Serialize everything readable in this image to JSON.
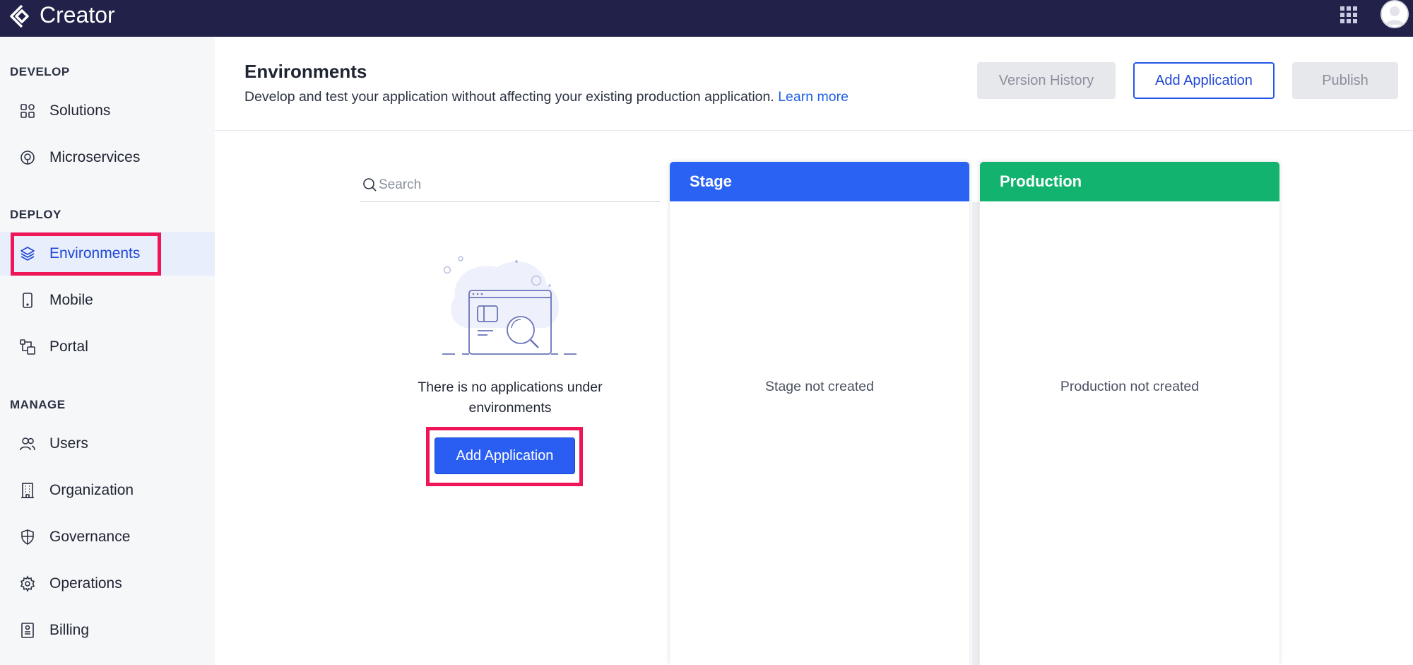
{
  "app": {
    "brand": "Creator"
  },
  "sidebar": {
    "sections": [
      {
        "label": "DEVELOP"
      },
      {
        "label": "DEPLOY"
      },
      {
        "label": "MANAGE"
      }
    ],
    "items": [
      {
        "label": "Solutions",
        "icon": "solutions-icon"
      },
      {
        "label": "Microservices",
        "icon": "microservices-icon"
      },
      {
        "label": "Environments",
        "icon": "layers-icon",
        "active": true
      },
      {
        "label": "Mobile",
        "icon": "mobile-icon"
      },
      {
        "label": "Portal",
        "icon": "portal-icon"
      },
      {
        "label": "Users",
        "icon": "users-icon"
      },
      {
        "label": "Organization",
        "icon": "building-icon"
      },
      {
        "label": "Governance",
        "icon": "shield-icon"
      },
      {
        "label": "Operations",
        "icon": "gear-icon"
      },
      {
        "label": "Billing",
        "icon": "billing-icon"
      }
    ]
  },
  "header": {
    "title": "Environments",
    "description": "Develop and test your application without affecting your existing production application.",
    "learn_more": "Learn more",
    "buttons": {
      "version_history": "Version History",
      "add_application": "Add Application",
      "publish": "Publish"
    }
  },
  "search": {
    "placeholder": "Search",
    "value": ""
  },
  "empty_state": {
    "message": "There is no applications under environments",
    "button": "Add Application"
  },
  "columns": [
    {
      "title": "Stage",
      "color": "#2a62f4",
      "empty_text": "Stage not created"
    },
    {
      "title": "Production",
      "color": "#12b36e",
      "empty_text": "Production not created"
    }
  ],
  "colors": {
    "topbar": "#21214a",
    "accent": "#2a5ef2",
    "highlight": "#ee1656"
  }
}
